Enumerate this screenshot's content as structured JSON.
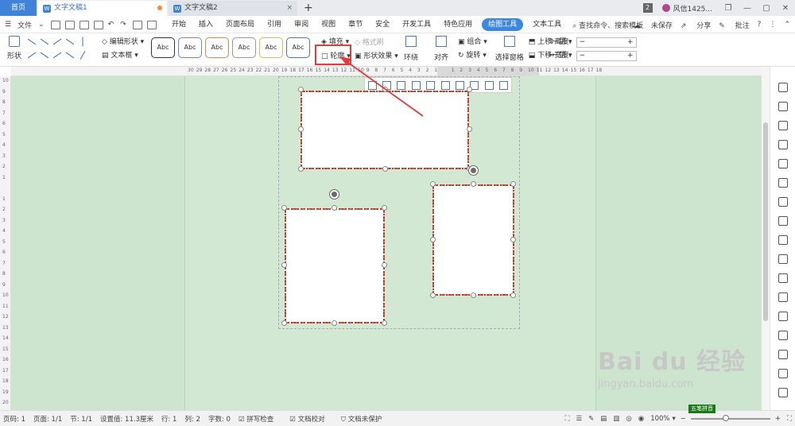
{
  "titlebar": {
    "home": "首页",
    "tab1": "文字文稿1",
    "tab2": "文字文稿2",
    "badge": "2",
    "user": "风信1425..."
  },
  "menubar": {
    "file": "文件",
    "tabs": [
      "开始",
      "插入",
      "页面布局",
      "引用",
      "审阅",
      "视图",
      "章节",
      "安全",
      "开发工具",
      "特色应用",
      "绘图工具",
      "文本工具"
    ],
    "active_tab": "绘图工具",
    "search": "查找命令、搜索模板",
    "unsaved": "未保存",
    "share": "分享",
    "comment": "批注"
  },
  "ribbon": {
    "shape": "形状",
    "edit_shape": "编辑形状",
    "text_box": "文本框",
    "style_label": "Abc",
    "style_colors": [
      "#333333",
      "#5b8ed6",
      "#e8864a",
      "#9a9a9a",
      "#e8b94a",
      "#4a78c8"
    ],
    "fill": "填充",
    "format_brush": "格式刷",
    "outline": "轮廓",
    "shape_effect": "形状效果",
    "wrap": "环绕",
    "align": "对齐",
    "group": "组合",
    "rotate": "旋转",
    "selection_pane": "选择窗格",
    "bring_forward": "上移一层",
    "send_backward": "下移一层",
    "height": "高度:",
    "width": "宽度:",
    "minus": "−",
    "plus": "+"
  },
  "ruler": {
    "h_ticks": [
      "30",
      "29",
      "28",
      "27",
      "26",
      "25",
      "24",
      "23",
      "22",
      "21",
      "20",
      "19",
      "18",
      "17",
      "16",
      "15",
      "14",
      "13",
      "12",
      "11",
      "10",
      "9",
      "8",
      "7",
      "6",
      "5",
      "4",
      "3",
      "2",
      "1",
      "",
      "1",
      "2",
      "3",
      "4",
      "5",
      "6",
      "7",
      "8",
      "9",
      "10",
      "11",
      "12",
      "13",
      "14",
      "15",
      "16",
      "17",
      "18"
    ],
    "v_ticks": [
      "10",
      "9",
      "8",
      "7",
      "6",
      "5",
      "4",
      "3",
      "2",
      "1",
      "",
      "1",
      "2",
      "3",
      "4",
      "5",
      "6",
      "7",
      "8",
      "9",
      "10",
      "11",
      "12",
      "13",
      "14",
      "15",
      "16",
      "17",
      "18",
      "19",
      "20"
    ]
  },
  "statusbar": {
    "page_num": "页码: 1",
    "pages": "页面: 1/1",
    "section": "节: 1/1",
    "setting": "设置值: 11.3厘米",
    "row": "行: 1",
    "col": "列: 2",
    "words": "字数: 0",
    "spell": "拼写检查",
    "proof": "文档校对",
    "protect": "文档未保护",
    "zoom": "100%"
  },
  "ime": "五笔拼音",
  "watermark": {
    "logo": "Bai du 经验",
    "url": "jingyan.baidu.com"
  }
}
